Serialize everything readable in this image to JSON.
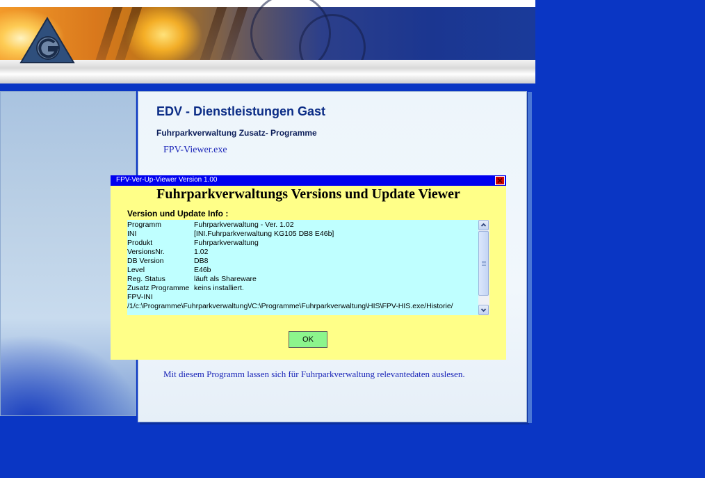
{
  "colors": {
    "page_background": "#0a36c4",
    "dialog_background": "#ffff88",
    "dialog_titlebar": "#0000f0",
    "info_box": "#bfffff",
    "ok_button": "#8cf58c",
    "link": "#1b26b8",
    "title": "#0b2c86"
  },
  "banner": {
    "logo_icon": "triangle-g-logo-icon"
  },
  "content": {
    "title": "EDV - Dienstleistungen Gast",
    "subtitle": "Fuhrparkverwaltung Zusatz- Programme",
    "exe_link": "FPV-Viewer.exe",
    "description": "Mit diesem Programm lassen sich für Fuhrparkverwaltung relevantedaten auslesen."
  },
  "dialog": {
    "title": "FPV-Ver-Up-Viewer Version 1.00",
    "close_icon": "close-icon",
    "heading": "Fuhrparkverwaltungs Versions und Update Viewer",
    "info_label": "Version und Update Info :",
    "rows": [
      {
        "key": "Programm",
        "value": "Fuhrparkverwaltung  - Ver. 1.02"
      },
      {
        "key": "INI",
        "value": "[INI.Fuhrparkverwaltung KG105 DB8 E46b]"
      },
      {
        "key": "Produkt",
        "value": "Fuhrparkverwaltung"
      },
      {
        "key": "VersionsNr.",
        "value": "1.02"
      },
      {
        "key": "DB Version",
        "value": "DB8"
      },
      {
        "key": "Level",
        "value": "E46b"
      },
      {
        "key": "Reg. Status",
        "value": "läuft als Shareware"
      },
      {
        "key": "Zusatz Programme",
        "value": "keins installiert."
      },
      {
        "key": "FPV-INI",
        "value": ""
      }
    ],
    "path_line": "/1/c:\\Programme\\Fuhrparkverwaltung\\/C:\\Programme\\Fuhrparkverwaltung\\HIS\\FPV-HIS.exe/Historie/",
    "ok_label": "OK"
  }
}
